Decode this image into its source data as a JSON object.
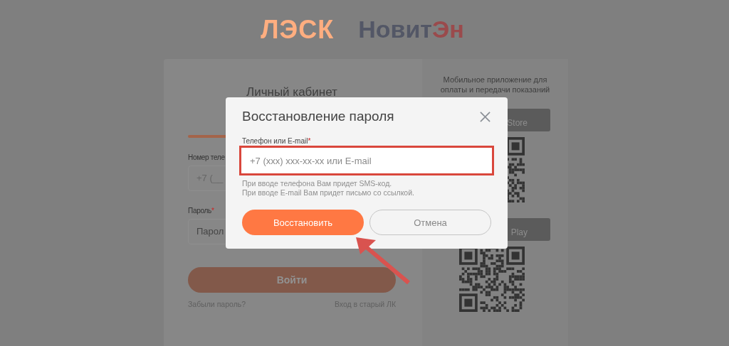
{
  "header": {
    "company_logo": "ЛЭСК",
    "brand_logo": {
      "main": "Новит",
      "accent": "Эн"
    }
  },
  "login": {
    "title": "Личный кабинет",
    "phone": {
      "label": "Номер теле",
      "value": "+7 (__"
    },
    "password": {
      "label": "Пароль",
      "required_mark": "*",
      "placeholder": "Парол"
    },
    "submit": "Войти",
    "links": [
      "Забыли пароль?",
      "Вход в старый ЛК"
    ]
  },
  "app_panel": {
    "caption": [
      "Мобильное приложение для",
      "оплаты и передачи показаний"
    ],
    "stores": [
      {
        "label": "Store"
      },
      {
        "label": "Play"
      }
    ]
  },
  "dialog": {
    "title": "Восстановление пароля",
    "field": {
      "label": "Телефон или E-mail",
      "required_mark": "*",
      "placeholder": "+7 (xxx) xxx-xx-xx или E-mail",
      "highlighted": true
    },
    "hints": [
      "При вводе телефона Вам придет SMS-код.",
      "При вводе E-mail Вам придет письмо со ссылкой."
    ],
    "buttons": [
      {
        "label": "Восстановить",
        "kind": "primary"
      },
      {
        "label": "Отмена",
        "kind": "secondary"
      }
    ]
  }
}
